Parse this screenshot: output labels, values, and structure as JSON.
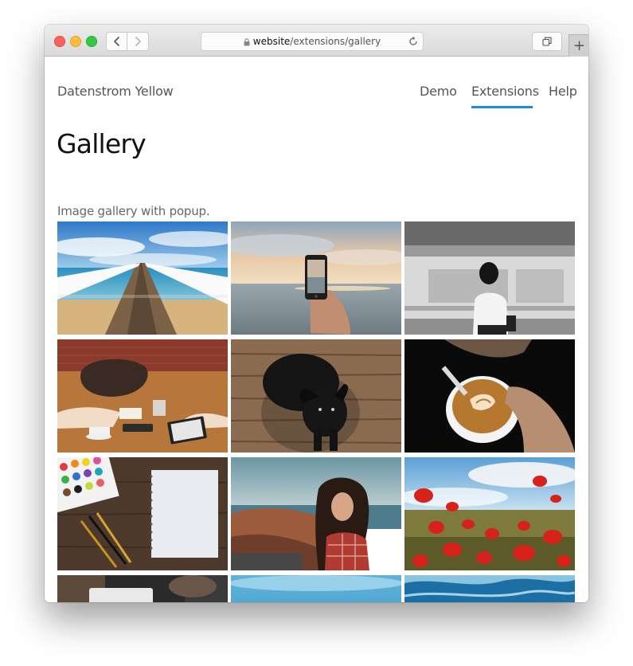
{
  "browser": {
    "url_domain": "website",
    "url_path": "/extensions/gallery"
  },
  "site": {
    "name": "Datenstrom Yellow",
    "nav": [
      {
        "label": "Demo"
      },
      {
        "label": "Extensions",
        "active": true
      },
      {
        "label": "Help"
      }
    ],
    "accent_color": "#1a8bd6"
  },
  "page": {
    "title": "Gallery",
    "description": "Image gallery with popup."
  },
  "gallery": {
    "images": [
      {
        "subject": "pier-over-sea"
      },
      {
        "subject": "phone-photo-sunset"
      },
      {
        "subject": "woman-subway"
      },
      {
        "subject": "desk-meeting"
      },
      {
        "subject": "black-puppy"
      },
      {
        "subject": "latte-art"
      },
      {
        "subject": "paints-notebook"
      },
      {
        "subject": "woman-coast"
      },
      {
        "subject": "poppy-field"
      },
      {
        "subject": "laptop-desk"
      },
      {
        "subject": "blue-sky"
      },
      {
        "subject": "ocean-waves"
      }
    ]
  },
  "icons": {
    "back": "chevron-left-icon",
    "forward": "chevron-right-icon",
    "lock": "lock-icon",
    "reload": "reload-icon",
    "tabs": "tabs-icon",
    "new_tab": "plus-icon"
  }
}
